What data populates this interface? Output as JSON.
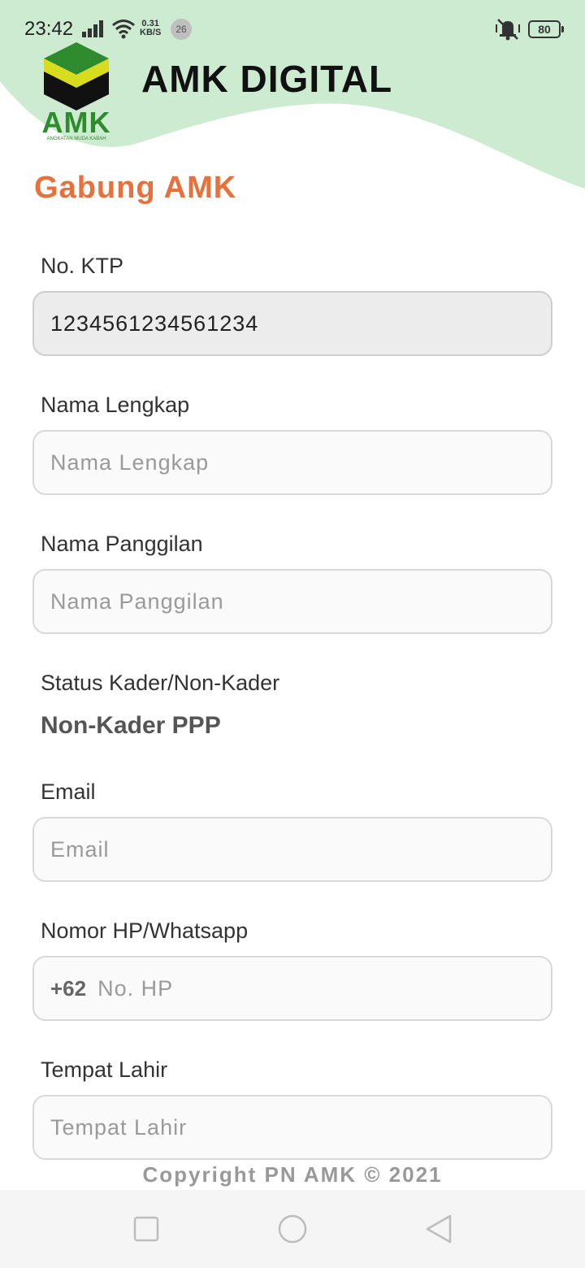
{
  "status_bar": {
    "time": "23:42",
    "net_speed_value": "0.31",
    "net_speed_unit": "KB/S",
    "notification_count": "26",
    "battery": "80"
  },
  "header": {
    "logo_text": "AMK",
    "logo_subtext": "ANGKATAN MUDA KABAH",
    "app_title": "AMK DIGITAL"
  },
  "page_title": "Gabung AMK",
  "form": {
    "ktp_label": "No. KTP",
    "ktp_value": "1234561234561234",
    "full_name_label": "Nama Lengkap",
    "full_name_placeholder": "Nama Lengkap",
    "nickname_label": "Nama Panggilan",
    "nickname_placeholder": "Nama Panggilan",
    "status_label": "Status Kader/Non-Kader",
    "status_value": "Non-Kader PPP",
    "email_label": "Email",
    "email_placeholder": "Email",
    "phone_label": "Nomor HP/Whatsapp",
    "phone_prefix": "+62",
    "phone_placeholder": "No. HP",
    "birthplace_label": "Tempat Lahir",
    "birthplace_placeholder": "Tempat Lahir"
  },
  "footer": {
    "copyright": "Copyright PN AMK © 2021"
  },
  "colors": {
    "header_wave": "#cdebd0",
    "title_accent": "#e8703a",
    "logo_green": "#2e8b2e",
    "logo_yellow": "#d8dc1e"
  }
}
